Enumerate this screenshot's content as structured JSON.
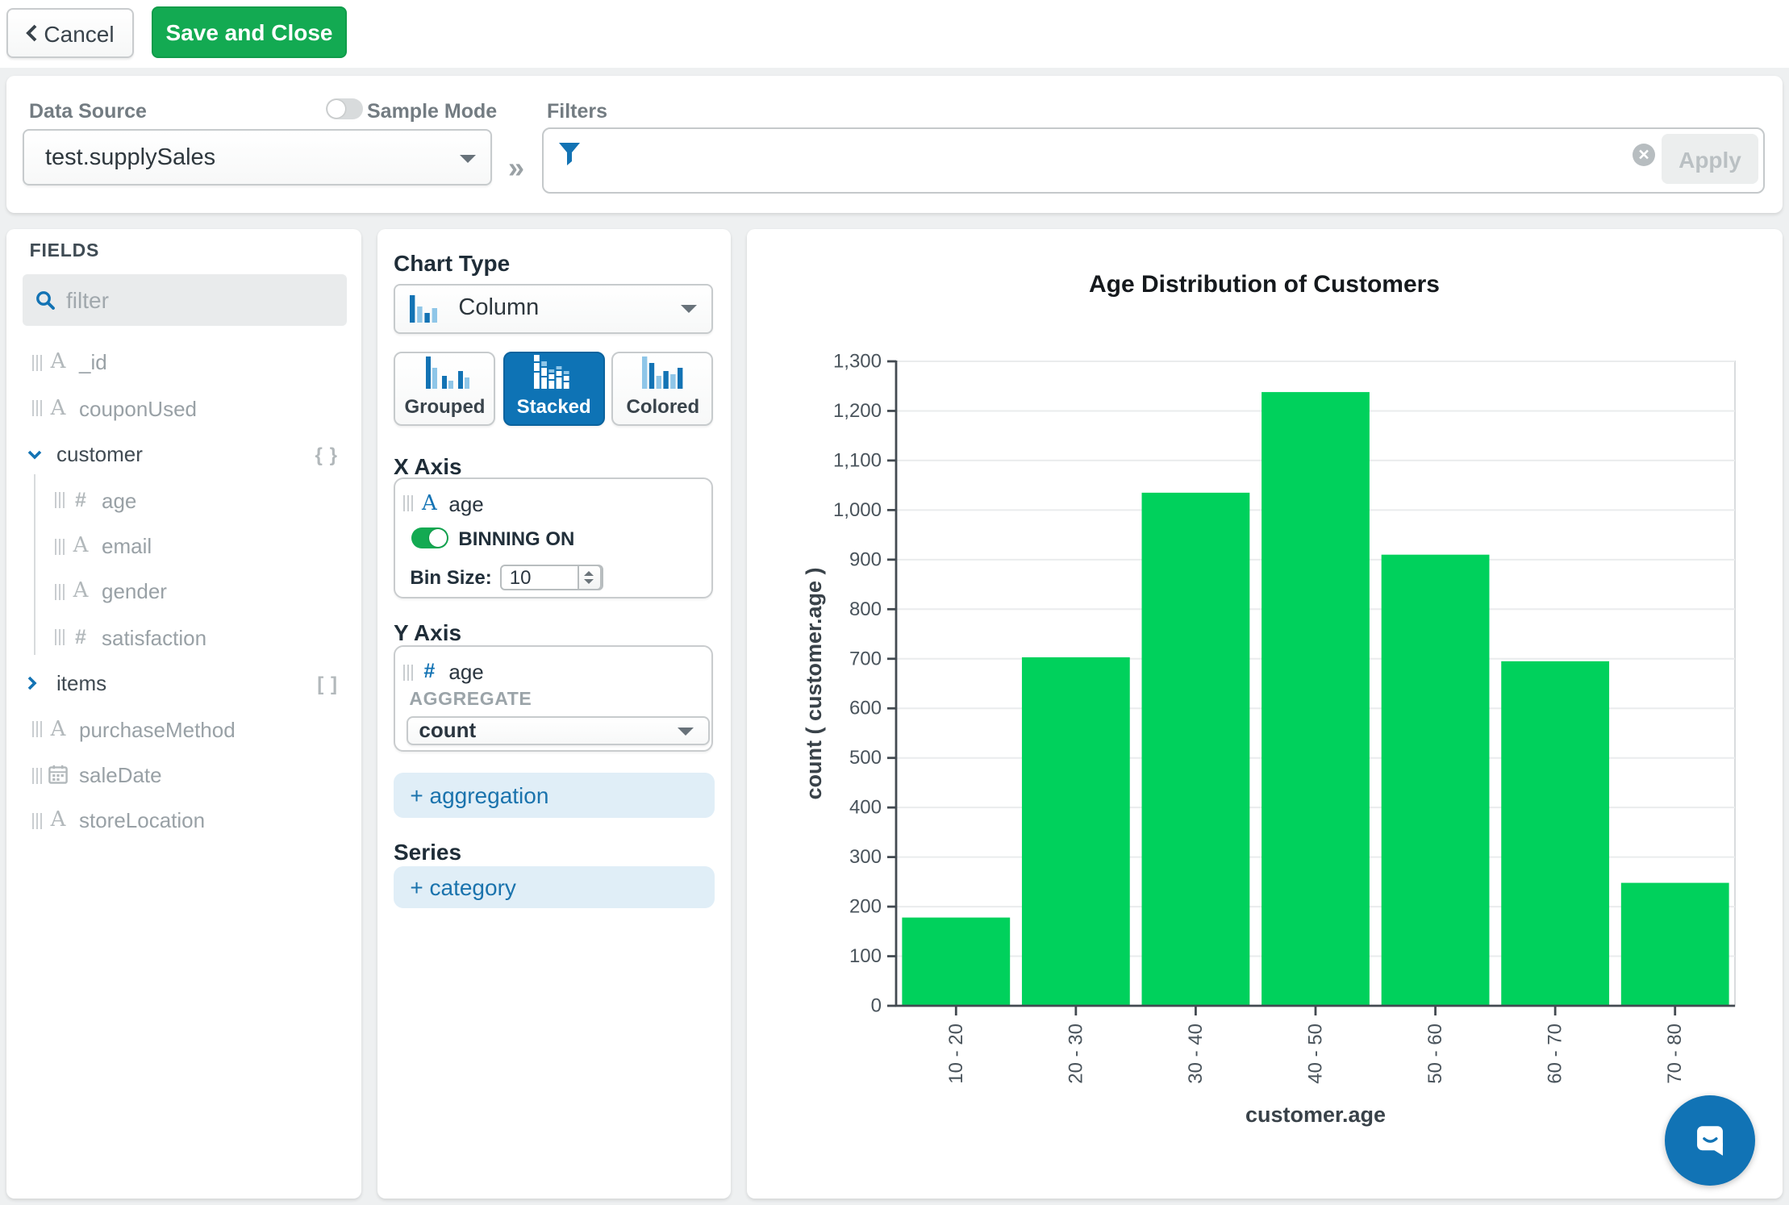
{
  "topbar": {
    "cancel_label": "Cancel",
    "save_label": "Save and Close"
  },
  "datasource": {
    "label": "Data Source",
    "value": "test.supplySales",
    "sample_mode_label": "Sample Mode",
    "sample_mode_on": false,
    "filters_label": "Filters",
    "filter_value": "",
    "apply_label": "Apply"
  },
  "fields": {
    "title": "FIELDS",
    "filter_placeholder": "filter",
    "items": [
      {
        "name": "_id",
        "type": "string",
        "level": 0
      },
      {
        "name": "couponUsed",
        "type": "string",
        "level": 0
      },
      {
        "name": "customer",
        "type": "object",
        "level": 0,
        "expanded": true
      },
      {
        "name": "age",
        "type": "number",
        "level": 1
      },
      {
        "name": "email",
        "type": "string",
        "level": 1
      },
      {
        "name": "gender",
        "type": "string",
        "level": 1
      },
      {
        "name": "satisfaction",
        "type": "number",
        "level": 1
      },
      {
        "name": "items",
        "type": "array",
        "level": 0,
        "expanded": false
      },
      {
        "name": "purchaseMethod",
        "type": "string",
        "level": 0
      },
      {
        "name": "saleDate",
        "type": "date",
        "level": 0
      },
      {
        "name": "storeLocation",
        "type": "string",
        "level": 0
      }
    ]
  },
  "config": {
    "chart_type_label": "Chart Type",
    "chart_type_value": "Column",
    "variants": [
      {
        "label": "Grouped",
        "selected": false
      },
      {
        "label": "Stacked",
        "selected": true
      },
      {
        "label": "Colored",
        "selected": false
      }
    ],
    "x_axis": {
      "label": "X Axis",
      "field": "age",
      "binning_label": "BINNING ON",
      "binning_on": true,
      "bin_size_label": "Bin Size:",
      "bin_size": "10"
    },
    "y_axis": {
      "label": "Y Axis",
      "field": "age",
      "aggregate_label": "AGGREGATE",
      "aggregate_value": "count"
    },
    "add_aggregation_label": "+ aggregation",
    "series_label": "Series",
    "add_category_label": "+ category"
  },
  "chart_data": {
    "type": "bar",
    "title": "Age Distribution of Customers",
    "xlabel": "customer.age",
    "ylabel": "count ( customer.age )",
    "categories": [
      "10 - 20",
      "20 - 30",
      "30 - 40",
      "40 - 50",
      "50 - 60",
      "60 - 70",
      "70 - 80"
    ],
    "values": [
      178,
      703,
      1035,
      1238,
      910,
      695,
      248
    ],
    "ylim": [
      0,
      1300
    ],
    "ytick_step": 100,
    "grid": true,
    "legend": false,
    "bar_color": "#00d15c"
  },
  "colors": {
    "accent_blue": "#1373b4",
    "accent_green": "#13aa52",
    "bar_green": "#00d15c"
  }
}
